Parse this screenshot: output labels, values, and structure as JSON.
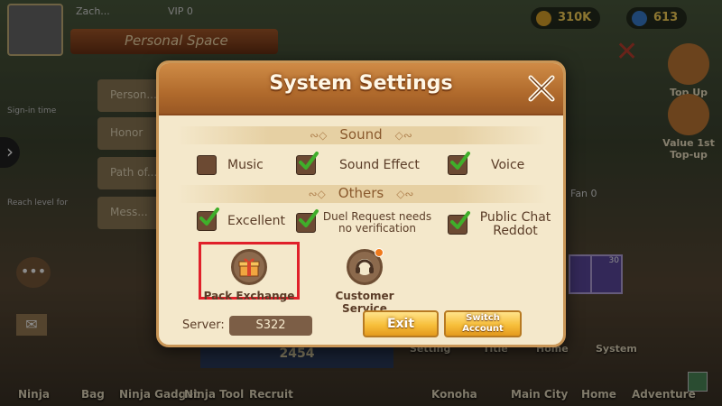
{
  "header": {
    "player_name": "Zach...",
    "vip": "VIP 0",
    "banner": "Personal Space",
    "coin_value": "310K",
    "gem_value": "613"
  },
  "left_panel": {
    "tabs": [
      "Person...",
      "Honor",
      "Path of...",
      "Mess..."
    ],
    "texts": [
      "Sign-in time",
      "Reach level for"
    ]
  },
  "right_panel": {
    "top_up": "Top Up",
    "value_top_up": "Value 1st Top-up",
    "fan_label": "Fan 0",
    "card_values": [
      "",
      "30"
    ]
  },
  "background_menu": {
    "setting": "Setting",
    "title": "Title",
    "home": "Home",
    "system": "System",
    "score": "2454"
  },
  "bottom_nav": {
    "items": [
      "Ninja",
      "Bag",
      "Ninja Gadget",
      "Ninja Tool",
      "Recruit",
      "Konoha",
      "Main City",
      "Home",
      "Adventure"
    ]
  },
  "modal": {
    "title": "System Settings",
    "sound": {
      "heading": "Sound",
      "options": [
        {
          "label": "Music",
          "checked": false
        },
        {
          "label": "Sound Effect",
          "checked": true
        },
        {
          "label": "Voice",
          "checked": true
        }
      ]
    },
    "others": {
      "heading": "Others",
      "options": [
        {
          "label": "Excellent",
          "checked": true
        },
        {
          "label": "Duel Request needs no verification",
          "checked": true
        },
        {
          "label": "Public Chat Reddot",
          "checked": true
        }
      ]
    },
    "features": {
      "pack_exchange": "Pack Exchange",
      "customer_service": "Customer Service"
    },
    "server_label": "Server:",
    "server_value": "S322",
    "exit_label": "Exit",
    "switch_account_label": "Switch Account"
  },
  "colors": {
    "header": "#b06a2c",
    "panel": "#f4e8cb",
    "checkbox": "#6c4a33",
    "check_green": "#3fae2a",
    "gold_button": "#f7bf3b",
    "highlight": "#e0202a"
  },
  "icons": {
    "close": "crossed-swords-close-icon",
    "pack_exchange": "gift-box-icon",
    "customer_service": "headset-icon"
  }
}
